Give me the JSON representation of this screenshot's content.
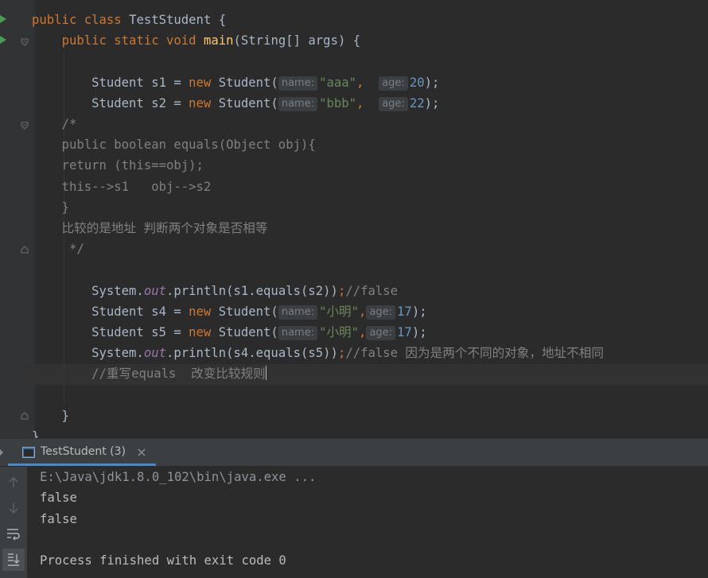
{
  "editor": {
    "lines": [
      [
        {
          "t": "public class ",
          "c": "kw"
        },
        {
          "t": "TestStudent {"
        }
      ],
      [
        {
          "t": "    "
        },
        {
          "t": "public static void ",
          "c": "kw"
        },
        {
          "t": "main",
          "c": "fn"
        },
        {
          "t": "(String[] args) {"
        }
      ],
      [],
      [
        {
          "t": "        Student s1 = "
        },
        {
          "t": "new ",
          "c": "kw"
        },
        {
          "t": "Student("
        },
        {
          "h": "name:"
        },
        {
          "t": "\"aaa\"",
          "c": "str"
        },
        {
          "t": ",  ",
          "c": "kw"
        },
        {
          "h": "age:"
        },
        {
          "t": "20",
          "c": "num"
        },
        {
          "t": ");"
        }
      ],
      [
        {
          "t": "        Student s2 = "
        },
        {
          "t": "new ",
          "c": "kw"
        },
        {
          "t": "Student("
        },
        {
          "h": "name:"
        },
        {
          "t": "\"bbb\"",
          "c": "str"
        },
        {
          "t": ",  ",
          "c": "kw"
        },
        {
          "h": "age:"
        },
        {
          "t": "22",
          "c": "num"
        },
        {
          "t": ");"
        }
      ],
      [
        {
          "t": "    /*",
          "c": "cmt"
        }
      ],
      [
        {
          "t": "    public boolean equals(Object obj){",
          "c": "cmt"
        }
      ],
      [
        {
          "t": "    return (this==obj);",
          "c": "cmt"
        }
      ],
      [
        {
          "t": "    this-->s1   obj-->s2",
          "c": "cmt"
        }
      ],
      [
        {
          "t": "    }",
          "c": "cmt"
        }
      ],
      [
        {
          "t": "    比较的是地址 判断两个对象是否相等",
          "c": "cmt"
        }
      ],
      [
        {
          "t": "     */",
          "c": "cmt"
        }
      ],
      [],
      [
        {
          "t": "        System."
        },
        {
          "t": "out",
          "c": "fld"
        },
        {
          "t": ".println(s1.equals(s2))"
        },
        {
          "t": ";",
          "c": "kw"
        },
        {
          "t": "//false",
          "c": "cmt"
        }
      ],
      [
        {
          "t": "        Student s4 = "
        },
        {
          "t": "new ",
          "c": "kw"
        },
        {
          "t": "Student("
        },
        {
          "h": "name:"
        },
        {
          "t": "\"小明\"",
          "c": "str"
        },
        {
          "t": ",",
          "c": "kw"
        },
        {
          "h": "age:"
        },
        {
          "t": "17",
          "c": "num"
        },
        {
          "t": ");"
        }
      ],
      [
        {
          "t": "        Student s5 = "
        },
        {
          "t": "new ",
          "c": "kw"
        },
        {
          "t": "Student("
        },
        {
          "h": "name:"
        },
        {
          "t": "\"小明\"",
          "c": "str"
        },
        {
          "t": ",",
          "c": "kw"
        },
        {
          "h": "age:"
        },
        {
          "t": "17",
          "c": "num"
        },
        {
          "t": ");"
        }
      ],
      [
        {
          "t": "        System."
        },
        {
          "t": "out",
          "c": "fld"
        },
        {
          "t": ".println(s4.equals(s5))"
        },
        {
          "t": ";",
          "c": "kw"
        },
        {
          "t": "//false 因为是两个不同的对象，地址不相同",
          "c": "cmt"
        }
      ],
      [
        {
          "t": "        //重写equals  改变比较规则",
          "c": "cmt"
        },
        {
          "caret": true
        }
      ],
      [],
      [
        {
          "t": "    }"
        }
      ],
      [
        {
          "t": "}"
        }
      ]
    ]
  },
  "run_panel": {
    "tab_label": "TestStudent (3)",
    "tab_icon": "console-icon",
    "close_icon": "close-icon",
    "toolbar_icons": [
      "up-arrow-icon",
      "down-arrow-icon",
      "soft-wrap-icon",
      "scroll-to-end-icon"
    ],
    "output": [
      "E:\\Java\\jdk1.8.0_102\\bin\\java.exe ...",
      "false",
      "false",
      "",
      "Process finished with exit code 0"
    ]
  },
  "colors": {
    "editor_bg": "#2b2b2b",
    "keyword": "#cc7832",
    "method": "#ffc66d",
    "string": "#6a8759",
    "number": "#6897bb",
    "comment": "#808080",
    "static_field": "#9876aa",
    "run_gutter_icon": "#499c54",
    "active_tab_underline": "#4a88c7"
  }
}
